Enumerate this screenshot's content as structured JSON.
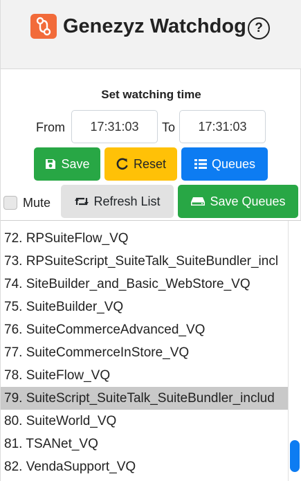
{
  "header": {
    "title": "Genezyz Watchdog",
    "help_icon": "question-circle-icon",
    "brand_color": "#f26b3a"
  },
  "watch": {
    "section_title": "Set watching time",
    "from_label": "From",
    "from_value": "17:31:03",
    "to_label": "To",
    "to_value": "17:31:03"
  },
  "buttons": {
    "save": "Save",
    "reset": "Reset",
    "queues": "Queues",
    "mute": "Mute",
    "refresh": "Refresh List",
    "save_queues": "Save Queues"
  },
  "colors": {
    "green": "#28a745",
    "yellow": "#ffc107",
    "blue": "#0d7cf2",
    "selected_row": "#c9c9c9"
  },
  "queue_list": {
    "items": [
      "72. RPSuiteFlow_VQ",
      "73. RPSuiteScript_SuiteTalk_SuiteBundler_incl",
      "74. SiteBuilder_and_Basic_WebStore_VQ",
      "75. SuiteBuilder_VQ",
      "76. SuiteCommerceAdvanced_VQ",
      "77. SuiteCommerceInStore_VQ",
      "78. SuiteFlow_VQ",
      "79. SuiteScript_SuiteTalk_SuiteBundler_includ",
      "80. SuiteWorld_VQ",
      "81. TSANet_VQ",
      "82. VendaSupport_VQ"
    ],
    "selected_index": 7,
    "mute_checked": false,
    "scroll_position": 0.97
  }
}
